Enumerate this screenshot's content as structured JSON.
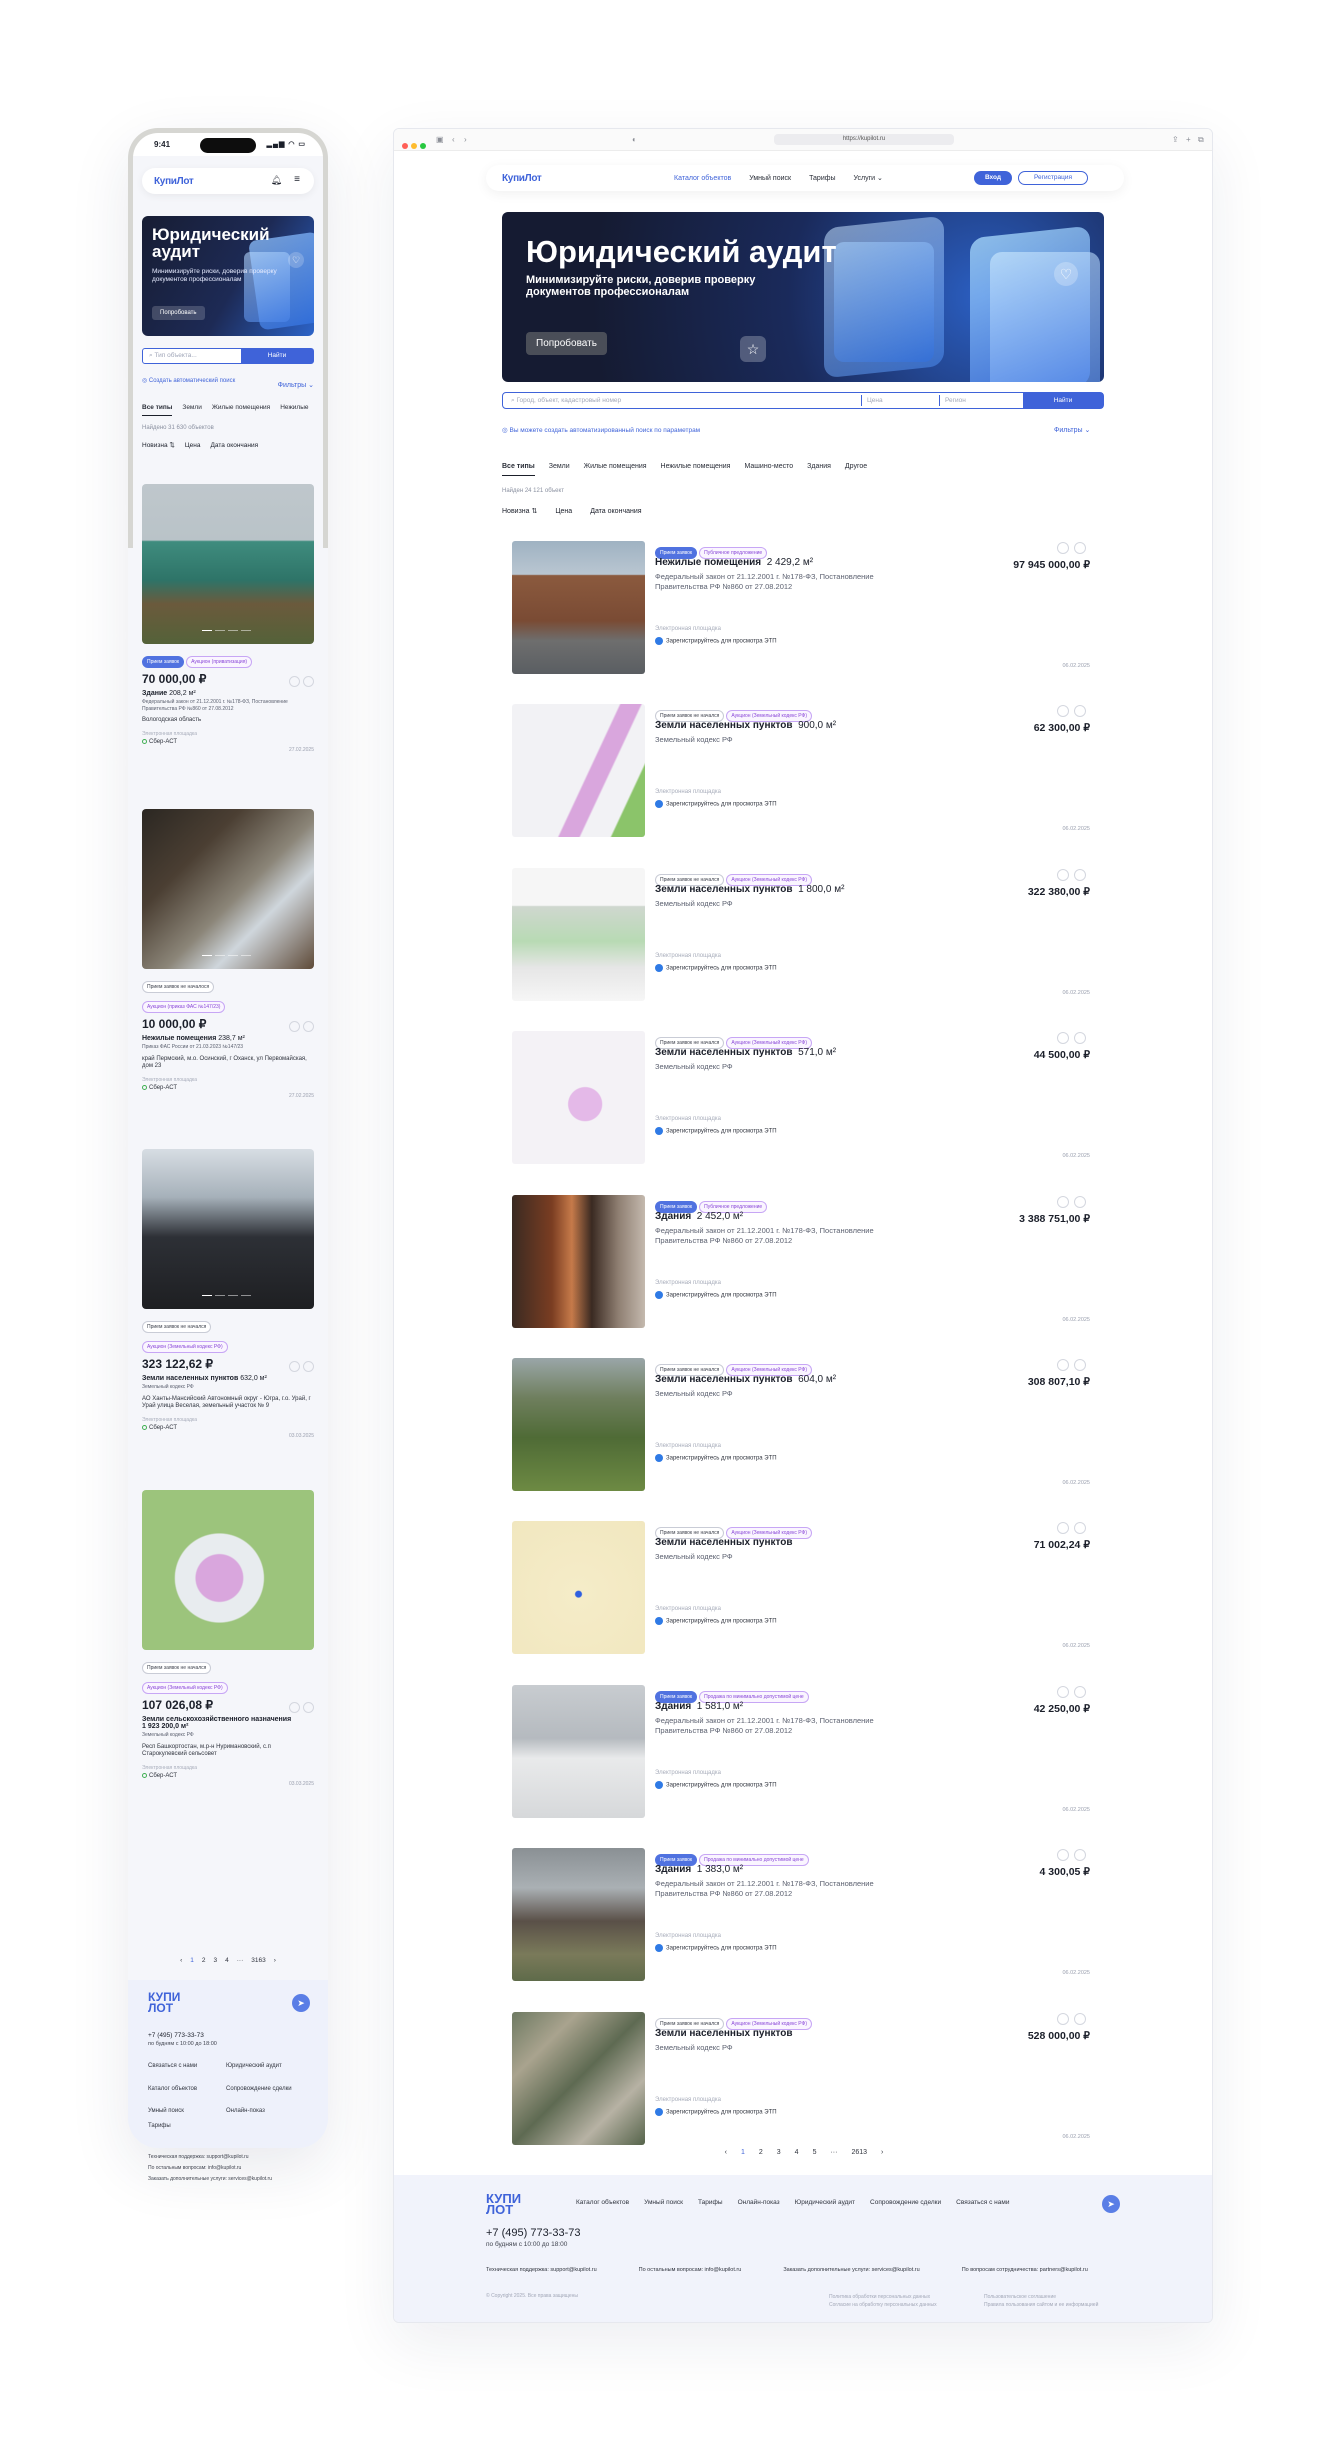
{
  "colors": {
    "accent": "#3f63d9",
    "dark": "#1b1f2a",
    "purple": "#8a48d8",
    "green": "#3faf52"
  },
  "mobile": {
    "status_time": "9:41",
    "logo": "КупиЛот",
    "banner": {
      "title": "Юридический аудит",
      "subtitle": "Минимизируйте риски, доверив проверку документов профессионалам",
      "button": "Попробовать"
    },
    "search_placeholder": "Тип объекта...",
    "search_button": "Найти",
    "auto_search": "Создать автоматический поиск",
    "filters": "Фильтры",
    "tabs": [
      "Все типы",
      "Земли",
      "Жилые помещения",
      "Нежилые"
    ],
    "found": "Найдено 31 630 объектов",
    "sort": [
      "Новизна ⇅",
      "Цена",
      "Дата окончания"
    ],
    "cards": [
      {
        "tags": [
          "Прием заявок",
          "Аукцион (приватизация)"
        ],
        "price": "70 000,00 ₽",
        "title": "Здание",
        "area": "208,2 м²",
        "law": "Федеральный закон от 21.12.2001 г. №178-ФЗ, Постановление Правительства РФ №860 от 27.08.2012",
        "location": "Вологодская область",
        "ep_label": "Электронная площадка",
        "platform": "Сбер-АСТ",
        "date": "27.02.2025"
      },
      {
        "tags": [
          "Прием заявок не началося",
          "Аукцион (приказ ФАС №147/23)"
        ],
        "price": "10 000,00 ₽",
        "title": "Нежилые помещения",
        "area": "238,7 м²",
        "law": "Приказ ФАС России от 21.03.2023 №147/23",
        "location": "край Пермский, м.о. Осинский, г Оханск, ул Первомайская, дом 23",
        "ep_label": "Электронная площадка",
        "platform": "Сбер-АСТ",
        "date": "27.02.2025"
      },
      {
        "tags": [
          "Прием заявок не начался",
          "Аукцион (Земельный кодекс РФ)"
        ],
        "price": "323 122,62 ₽",
        "title": "Земли населенных пунктов",
        "area": "632,0 м²",
        "law": "Земельный кодекс РФ",
        "location": "АО Ханты-Мансийский Автономный округ - Югра, г.о. Урай, г Урай улица Веселая, земельный участок № 9",
        "ep_label": "Электронная площадка",
        "platform": "Сбер-АСТ",
        "date": "03.03.2025"
      },
      {
        "tags": [
          "Прием заявок не начался",
          "Аукцион (Земельный кодекс РФ)"
        ],
        "price": "107 026,08 ₽",
        "title": "Земли сельскохозяйственного назначения",
        "area": "1 923 200,0 м²",
        "law": "Земельный кодекс РФ",
        "location": "Респ Башкортостан, м.р-н Нуримановский, с.п Старокулевский сельсовет",
        "ep_label": "Электронная площадка",
        "platform": "Сбер-АСТ",
        "date": "03.03.2025"
      }
    ],
    "pager": [
      "‹",
      "1",
      "2",
      "3",
      "4",
      "···",
      "3163",
      "›"
    ],
    "footer": {
      "logo": "КУПИ ЛОТ",
      "phone": "+7 (495) 773-33-73",
      "hours": "по будням с 10:00 до 18:00",
      "links": [
        "Связаться с нами",
        "Юридический аудит",
        "Каталог объектов",
        "Сопровождение сделки",
        "Умный поиск",
        "Онлайн-показ",
        "Тарифы"
      ],
      "mails": [
        "Техническая поддержка: support@kupilot.ru",
        "По остальным вопросам: info@kupilot.ru",
        "Заказать дополнительные услуги: services@kupilot.ru"
      ]
    }
  },
  "desktop": {
    "url": "https://kupilot.ru",
    "logo": "КупиЛот",
    "nav": [
      "Каталог объектов",
      "Умный поиск",
      "Тарифы",
      "Услуги ⌄"
    ],
    "login": "Вход",
    "register": "Регистрация",
    "banner": {
      "title": "Юридический аудит",
      "subtitle": "Минимизируйте риски, доверив проверку документов профессионалам",
      "button": "Попробовать"
    },
    "search": {
      "placeholder_object": "Город, объект, кадастровый номер",
      "placeholder_price": "Цена",
      "placeholder_region": "Регион",
      "button": "Найти"
    },
    "auto_search": "Вы можете создать автоматизированный поиск по параметрам",
    "filters": "Фильтры",
    "tabs": [
      "Все типы",
      "Земли",
      "Жилые помещения",
      "Нежилые помещения",
      "Машино-место",
      "Здания",
      "Другое"
    ],
    "found": "Найден 24 121 объект",
    "sort": [
      "Новизна ⇅",
      "Цена",
      "Дата окончания"
    ],
    "ep_label": "Электронная площадка",
    "reg_label": "Зарегистрируйтесь для просмотра ЭТП",
    "cards": [
      {
        "tags": [
          "Прием заявок",
          "Публичное предложение"
        ],
        "title": "Нежилые помещения",
        "area": "2 429,2 м²",
        "law": "Федеральный закон от 21.12.2001 г. №178-ФЗ, Постановление Правительства РФ №860 от 27.08.2012",
        "price": "97 945 000,00 ₽",
        "date": "06.02.2025"
      },
      {
        "tags": [
          "Прием заявок не начался",
          "Аукцион (Земельный кодекс РФ)"
        ],
        "title": "Земли населенных пунктов",
        "area": "900,0 м²",
        "law": "Земельный кодекс РФ",
        "price": "62 300,00 ₽",
        "date": "06.02.2025"
      },
      {
        "tags": [
          "Прием заявок не начался",
          "Аукцион (Земельный кодекс РФ)"
        ],
        "title": "Земли населенных пунктов",
        "area": "1 800,0 м²",
        "law": "Земельный кодекс РФ",
        "price": "322 380,00 ₽",
        "date": "06.02.2025"
      },
      {
        "tags": [
          "Прием заявок не начался",
          "Аукцион (Земельный кодекс РФ)"
        ],
        "title": "Земли населенных пунктов",
        "area": "571,0 м²",
        "law": "Земельный кодекс РФ",
        "price": "44 500,00 ₽",
        "date": "06.02.2025"
      },
      {
        "tags": [
          "Прием заявок",
          "Публичное предложение"
        ],
        "title": "Здания",
        "area": "2 452,0 м²",
        "law": "Федеральный закон от 21.12.2001 г. №178-ФЗ, Постановление Правительства РФ №860 от 27.08.2012",
        "price": "3 388 751,00 ₽",
        "date": "06.02.2025"
      },
      {
        "tags": [
          "Прием заявок не начался",
          "Аукцион (Земельный кодекс РФ)"
        ],
        "title": "Земли населенных пунктов",
        "area": "604,0 м²",
        "law": "Земельный кодекс РФ",
        "price": "308 807,10 ₽",
        "date": "06.02.2025"
      },
      {
        "tags": [
          "Прием заявок не начался",
          "Аукцион (Земельный кодекс РФ)"
        ],
        "title": "Земли населенных пунктов",
        "area": "",
        "law": "Земельный кодекс РФ",
        "price": "71 002,24 ₽",
        "date": "06.02.2025"
      },
      {
        "tags": [
          "Прием заявок",
          "Продажа по минимально допустимой цене"
        ],
        "title": "Здания",
        "area": "1 581,0 м²",
        "law": "Федеральный закон от 21.12.2001 г. №178-ФЗ, Постановление Правительства РФ №860 от 27.08.2012",
        "price": "42 250,00 ₽",
        "date": "06.02.2025"
      },
      {
        "tags": [
          "Прием заявок",
          "Продажа по минимально допустимой цене"
        ],
        "title": "Здания",
        "area": "1 383,0 м²",
        "law": "Федеральный закон от 21.12.2001 г. №178-ФЗ, Постановление Правительства РФ №860 от 27.08.2012",
        "price": "4 300,05 ₽",
        "date": "06.02.2025"
      },
      {
        "tags": [
          "Прием заявок не начался",
          "Аукцион (Земельный кодекс РФ)"
        ],
        "title": "Земли населенных пунктов",
        "area": "",
        "law": "Земельный кодекс РФ",
        "price": "528 000,00 ₽",
        "date": "06.02.2025"
      }
    ],
    "pager": [
      "‹",
      "1",
      "2",
      "3",
      "4",
      "5",
      "···",
      "2613",
      "›"
    ],
    "footer": {
      "logo": "КУПИ ЛОТ",
      "links": [
        "Каталог объектов",
        "Умный поиск",
        "Тарифы",
        "Онлайн-показ",
        "Юридический аудит",
        "Сопровождение сделки",
        "Связаться с нами"
      ],
      "phone": "+7 (495) 773-33-73",
      "hours": "по будням с 10:00 до 18:00",
      "mails": [
        "Техническая поддержка: support@kupilot.ru",
        "По остальным вопросам: info@kupilot.ru",
        "Заказать дополнительные услуги: services@kupilot.ru",
        "По вопросам сотрудничества: partners@kupilot.ru"
      ],
      "copyright": "© Copyright 2025. Все права защищены",
      "policies": [
        "Политика обработки персональных данных",
        "Согласие на обработку персональных данных",
        "Пользовательское соглашение",
        "Правила пользования сайтом и ее информацией"
      ]
    }
  }
}
